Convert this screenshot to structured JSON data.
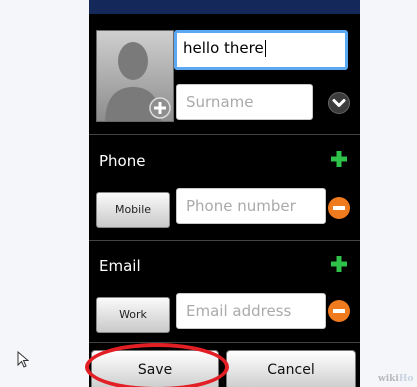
{
  "contact_form": {
    "name_value": "hello there",
    "surname_placeholder": "Surname",
    "phone": {
      "section_label": "Phone",
      "type_label": "Mobile",
      "number_placeholder": "Phone number"
    },
    "email": {
      "section_label": "Email",
      "type_label": "Work",
      "address_placeholder": "Email address"
    },
    "save_label": "Save",
    "cancel_label": "Cancel"
  },
  "watermark": {
    "brand_main": "wiki",
    "brand_suffix": "Ho"
  },
  "colors": {
    "focus_border": "#5aa9f2",
    "add_icon": "#2ec24a",
    "remove_button": "#f07a1e",
    "highlight_ring": "#e21f24",
    "header_bar": "#14285a"
  },
  "icons": {
    "photo": "contact-photo-placeholder",
    "add_photo": "plus-circle-icon",
    "expand": "chevron-down-icon",
    "add": "plus-icon",
    "remove": "minus-icon",
    "cursor": "mouse-pointer-icon"
  }
}
